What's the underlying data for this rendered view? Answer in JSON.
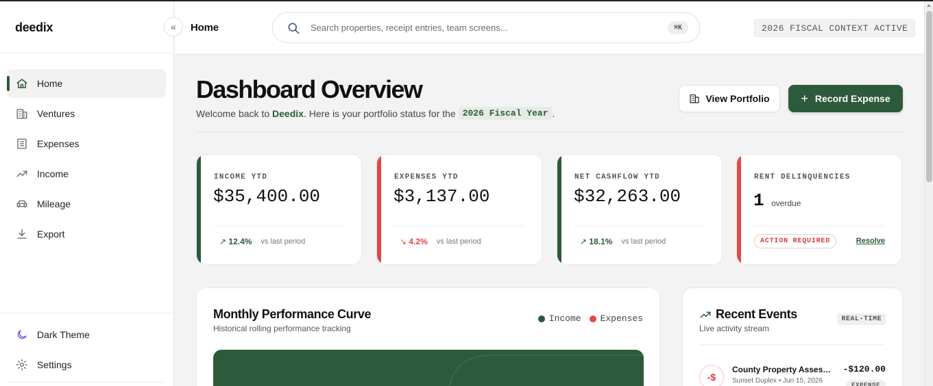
{
  "app": {
    "name": "deedix"
  },
  "sidebar": {
    "collapse_icon": "double-chevron-left-icon",
    "collapse_glyph": "«",
    "items": [
      {
        "label": "Home",
        "icon": "home-icon",
        "active": true
      },
      {
        "label": "Ventures",
        "icon": "building-icon"
      },
      {
        "label": "Expenses",
        "icon": "receipt-icon"
      },
      {
        "label": "Income",
        "icon": "trending-up-icon"
      },
      {
        "label": "Mileage",
        "icon": "car-icon"
      },
      {
        "label": "Export",
        "icon": "download-icon"
      }
    ],
    "bottom_items": [
      {
        "label": "Dark Theme",
        "icon": "moon-icon"
      },
      {
        "label": "Settings",
        "icon": "gear-icon"
      }
    ]
  },
  "header": {
    "title": "Home",
    "search": {
      "placeholder": "Search properties, receipt entries, team screens...",
      "shortcut": "⌘K"
    },
    "fiscal_badge": "2026 FISCAL CONTEXT ACTIVE"
  },
  "main": {
    "title": "Dashboard Overview",
    "subtitle_prefix": "Welcome back to",
    "subtitle_brand": "Deedix",
    "subtitle_mid": ". Here is your portfolio status for the",
    "subtitle_code": "2026 Fiscal Year",
    "subtitle_end": ".",
    "buttons": {
      "portfolio": "View Portfolio",
      "record": "Record Expense",
      "record_glyph": "+"
    },
    "stats": [
      {
        "label": "INCOME YTD",
        "value": "$35,400.00",
        "trend": "12.4%",
        "trend_arrow": "↗",
        "trend_dir": "up",
        "vs": "vs last period",
        "color": "#2d5a3a"
      },
      {
        "label": "EXPENSES YTD",
        "value": "$3,137.00",
        "trend": "4.2%",
        "trend_arrow": "↘",
        "trend_dir": "down",
        "vs": "vs last period",
        "color": "#e04848"
      },
      {
        "label": "NET CASHFLOW YTD",
        "value": "$32,263.00",
        "trend": "18.1%",
        "trend_arrow": "↗",
        "trend_dir": "up",
        "vs": "vs last period",
        "color": "#2d5a3a"
      }
    ],
    "delinquency": {
      "label": "RENT DELINQUENCIES",
      "count": "1",
      "count_label": "overdue",
      "badge": "ACTION REQUIRED",
      "link": "Resolve",
      "color": "#e04848"
    },
    "performance": {
      "title": "Monthly Performance Curve",
      "subtitle": "Historical rolling performance tracking",
      "legend": [
        {
          "label": "Income",
          "color": "#2d5a3a"
        },
        {
          "label": "Expenses",
          "color": "#e04848"
        }
      ]
    },
    "events": {
      "title": "Recent Events",
      "subtitle": "Live activity stream",
      "badge": "REAL-TIME",
      "items": [
        {
          "icon": "-$",
          "name": "County Property Assessment",
          "meta": "Sunset Duplex • Jun 15, 2026",
          "amount": "-$120.00",
          "tag": "EXPENSE"
        }
      ]
    }
  },
  "colors": {
    "accent": "#2d5a3a",
    "danger": "#e04848"
  }
}
